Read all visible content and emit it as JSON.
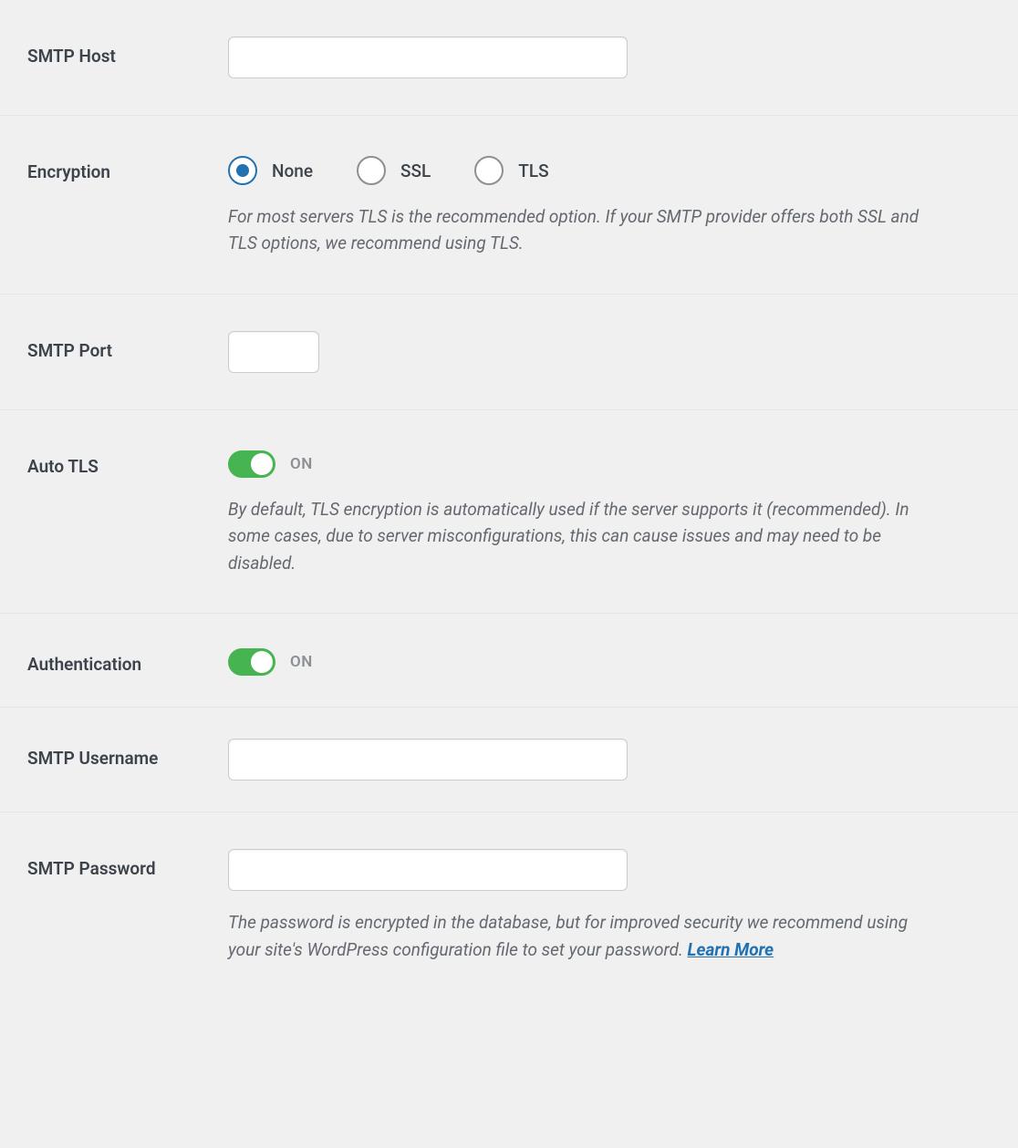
{
  "smtp_host": {
    "label": "SMTP Host",
    "value": ""
  },
  "encryption": {
    "label": "Encryption",
    "options": {
      "none": "None",
      "ssl": "SSL",
      "tls": "TLS"
    },
    "description": "For most servers TLS is the recommended option. If your SMTP provider offers both SSL and TLS options, we recommend using TLS."
  },
  "smtp_port": {
    "label": "SMTP Port",
    "value": ""
  },
  "auto_tls": {
    "label": "Auto TLS",
    "status": "ON",
    "description": "By default, TLS encryption is automatically used if the server supports it (recommended). In some cases, due to server misconfigurations, this can cause issues and may need to be disabled."
  },
  "authentication": {
    "label": "Authentication",
    "status": "ON"
  },
  "smtp_username": {
    "label": "SMTP Username",
    "value": ""
  },
  "smtp_password": {
    "label": "SMTP Password",
    "value": "",
    "description": "The password is encrypted in the database, but for improved security we recommend using your site's WordPress configuration file to set your password. ",
    "learn_more": "Learn More"
  }
}
